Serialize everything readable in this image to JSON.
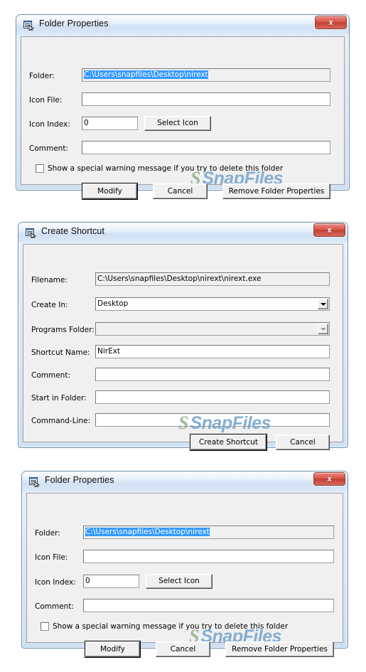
{
  "background_color": "#ffffff",
  "accent": {
    "titlebar_blue": "#cfe1f4",
    "close_red": "#c43f33",
    "selection_blue": "#3399ff",
    "watermark_blue": "#7ba7cc",
    "watermark_green": "#8fae8c"
  },
  "watermark": {
    "logo": "S",
    "text": "SnapFiles"
  },
  "dialogs": [
    {
      "id": "folder-properties-1",
      "title": "Folder Properties",
      "close_label": "x",
      "fields": [
        {
          "label": "Folder:",
          "value": "C:\\Users\\snapfiles\\Desktop\\nirext",
          "selected": true,
          "readonly": true
        },
        {
          "label": "Icon File:",
          "value": "",
          "selected": false,
          "readonly": false
        },
        {
          "label": "Icon Index:",
          "value": "0",
          "selected": false,
          "readonly": false
        },
        {
          "label": "Comment:",
          "value": "",
          "selected": false,
          "readonly": false
        }
      ],
      "select_icon_button": "Select Icon",
      "checkbox": {
        "label": "Show a special warning message if you try to delete this folder",
        "checked": false
      },
      "buttons": [
        {
          "label": "Modify",
          "default": true
        },
        {
          "label": "Cancel",
          "default": false
        },
        {
          "label": "Remove Folder Properties",
          "default": false
        }
      ]
    },
    {
      "id": "create-shortcut",
      "title": "Create Shortcut",
      "close_label": "x",
      "fields": [
        {
          "label": "Filename:",
          "value": "C:\\Users\\snapfiles\\Desktop\\nirext\\nirext.exe",
          "readonly": true
        },
        {
          "label": "Create In:",
          "value": "Desktop",
          "type": "combo",
          "disabled": false
        },
        {
          "label": "Programs Folder:",
          "value": "",
          "type": "combo",
          "disabled": true
        },
        {
          "label": "Shortcut Name:",
          "value": "NirExt"
        },
        {
          "label": "Comment:",
          "value": ""
        },
        {
          "label": "Start in Folder:",
          "value": ""
        },
        {
          "label": "Command-Line:",
          "value": ""
        }
      ],
      "buttons": [
        {
          "label": "Create Shortcut",
          "default": true
        },
        {
          "label": "Cancel",
          "default": false
        }
      ]
    },
    {
      "id": "folder-properties-2",
      "title": "Folder Properties",
      "close_label": "x",
      "fields": [
        {
          "label": "Folder:",
          "value": "C:\\Users\\snapfiles\\Desktop\\nirext",
          "selected": true,
          "readonly": true
        },
        {
          "label": "Icon File:",
          "value": "",
          "selected": false,
          "readonly": false
        },
        {
          "label": "Icon Index:",
          "value": "0",
          "selected": false,
          "readonly": false
        },
        {
          "label": "Comment:",
          "value": "",
          "selected": false,
          "readonly": false
        }
      ],
      "select_icon_button": "Select Icon",
      "checkbox": {
        "label": "Show a special warning message if you try to delete this folder",
        "checked": false
      },
      "buttons": [
        {
          "label": "Modify",
          "default": true
        },
        {
          "label": "Cancel",
          "default": false
        },
        {
          "label": "Remove Folder Properties",
          "default": false
        }
      ]
    }
  ]
}
